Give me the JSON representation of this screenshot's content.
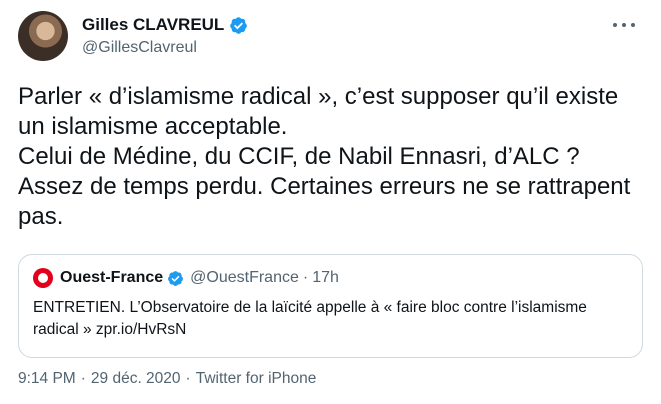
{
  "tweet": {
    "author": {
      "display_name": "Gilles CLAVREUL",
      "handle": "@GillesClavreul",
      "verified": true,
      "avatar": "profile-photo"
    },
    "more_icon": "more-options-icon",
    "text_lines": [
      "Parler « d’islamisme radical », c’est supposer qu’il existe",
      "un islamisme acceptable.",
      "Celui de Médine, du CCIF, de Nabil Ennasri, d’ALC ?",
      "Assez de temps perdu. Certaines erreurs ne se rattrapent",
      "pas."
    ],
    "quoted_tweet": {
      "display_name": "Ouest-France",
      "handle": "@OuestFrance",
      "separator": "·",
      "time": "17h",
      "verified": true,
      "text_lines": [
        "ENTRETIEN. L’Observatoire de la laïcité appelle à « faire bloc contre l’islamisme",
        "radical » zpr.io/HvRsN"
      ]
    },
    "meta": {
      "time": "9:14 PM",
      "separator": "·",
      "date": "29 déc. 2020",
      "separator2": "·",
      "source": "Twitter for iPhone"
    },
    "colors": {
      "verified_badge": "#1d9bf0",
      "secondary_text": "#536471",
      "ouest_france_red": "#e2001a"
    }
  }
}
